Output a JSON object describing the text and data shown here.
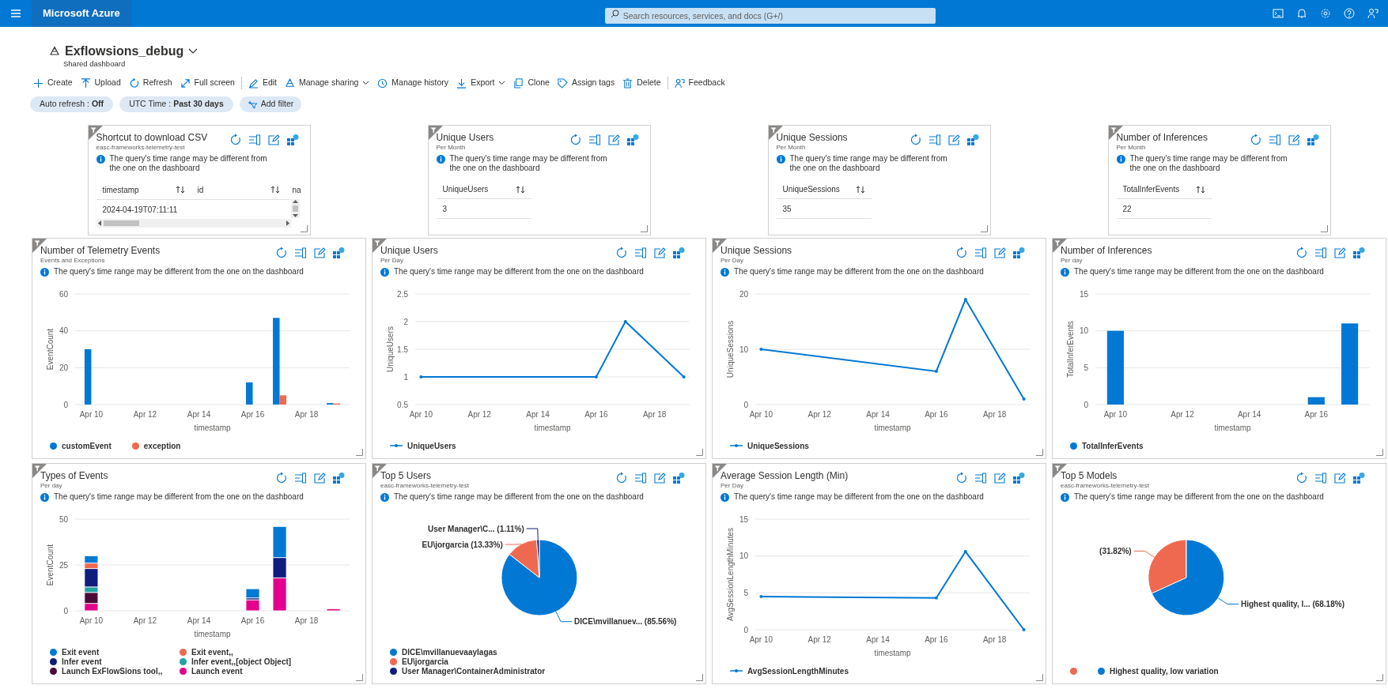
{
  "topbar": {
    "brand": "Microsoft Azure",
    "search": {
      "placeholder": "Search resources, services, and docs (G+/)"
    }
  },
  "dashboard": {
    "title": "Exflowsions_debug",
    "subtitle": "Shared dashboard"
  },
  "toolbar": [
    [
      {
        "label": "Create",
        "has_menu": false
      },
      {
        "label": "Upload",
        "has_menu": false
      },
      {
        "label": "Refresh",
        "has_menu": false
      },
      {
        "label": "Full screen",
        "has_menu": false
      }
    ],
    [
      {
        "label": "Edit",
        "has_menu": false
      },
      {
        "label": "Manage sharing",
        "has_menu": true
      },
      {
        "label": "Manage history",
        "has_menu": false
      },
      {
        "label": "Export",
        "has_menu": true
      },
      {
        "label": "Clone",
        "has_menu": false
      },
      {
        "label": "Assign tags",
        "has_menu": false
      },
      {
        "label": "Delete",
        "has_menu": false
      }
    ],
    [
      {
        "label": "Feedback",
        "has_menu": false
      }
    ]
  ],
  "filters": [
    {
      "kind": "value",
      "text": "Auto refresh : **Off**"
    },
    {
      "kind": "value",
      "text": "UTC Time : **Past 30 days**"
    },
    {
      "kind": "add",
      "text": "Add filter"
    }
  ],
  "tiles": [
    {
      "kind": "table",
      "title": "Shortcut to download CSV",
      "subtitle": "easc-frameworks-telemetry-test",
      "notice": "The query's time range may be different from the one on the dashboard",
      "scrollbars": true,
      "table": {
        "columns": [
          {
            "label": "timestamp",
            "sortable": true
          },
          {
            "label": "id",
            "sortable": true
          },
          {
            "label": "na",
            "sortable": false
          }
        ],
        "rows": [
          [
            "2024-04-19T07:11:11"
          ]
        ]
      }
    },
    {
      "kind": "table",
      "title": "Unique Users",
      "subtitle": "Per Month",
      "notice": "The query's time range may be different from the one on the dashboard",
      "scrollbars": false,
      "table": {
        "columns": [
          {
            "label": "UniqueUsers",
            "sortable": true
          }
        ],
        "rows": [
          [
            "3"
          ]
        ]
      }
    },
    {
      "kind": "table",
      "title": "Unique Sessions",
      "subtitle": "Per Month",
      "notice": "The query's time range may be different from the one on the dashboard",
      "scrollbars": false,
      "table": {
        "columns": [
          {
            "label": "UniqueSessions",
            "sortable": true
          }
        ],
        "rows": [
          [
            "35"
          ]
        ]
      }
    },
    {
      "kind": "table",
      "title": "Number of Inferences",
      "subtitle": "Per Month",
      "notice": "The query's time range may be different from the one on the dashboard",
      "scrollbars": false,
      "table": {
        "columns": [
          {
            "label": "TotalInferEvents",
            "sortable": true
          }
        ],
        "rows": [
          [
            "22"
          ]
        ]
      }
    },
    {
      "kind": "chart",
      "title": "Number of Telemetry Events",
      "subtitle": "Events and Exceptions",
      "notice": "The query's time range may be different from the one on the dashboard",
      "chart_data": {
        "type": "bar",
        "xlabel": "timestamp",
        "ylabel": "EventCount",
        "categories": [
          "Apr 10",
          null,
          "Apr 12",
          null,
          "Apr 14",
          null,
          "Apr 16",
          null,
          "Apr 18",
          null
        ],
        "grid": true,
        "ylim": [
          0,
          60
        ],
        "yticks": [
          0,
          20,
          40,
          60
        ],
        "stacked": false,
        "series": [
          {
            "name": "customEvent",
            "color": "#0078d4",
            "values": [
              30,
              null,
              null,
              null,
              null,
              null,
              12,
              47,
              null,
              0.8
            ]
          },
          {
            "name": "exception",
            "color": "#ef6950",
            "values": [
              null,
              null,
              null,
              null,
              null,
              null,
              null,
              5,
              null,
              0.6
            ]
          }
        ]
      }
    },
    {
      "kind": "chart",
      "title": "Unique Users",
      "subtitle": "Per Day",
      "notice": "The query's time range may be different from the one on the dashboard",
      "chart_data": {
        "type": "line",
        "xlabel": "timestamp",
        "ylabel": "UniqueUsers",
        "categories": [
          "Apr 10",
          null,
          "Apr 12",
          null,
          "Apr 14",
          null,
          "Apr 16",
          null,
          "Apr 18",
          null
        ],
        "grid": true,
        "ylim": [
          0.5,
          2.5
        ],
        "yticks": [
          0.5,
          1,
          1.5,
          2,
          2.5
        ],
        "series": [
          {
            "name": "UniqueUsers",
            "color": "#0078d4",
            "values": [
              1,
              null,
              null,
              null,
              null,
              null,
              1,
              2,
              null,
              1
            ]
          }
        ]
      }
    },
    {
      "kind": "chart",
      "title": "Unique Sessions",
      "subtitle": "Per Day",
      "notice": "The query's time range may be different from the one on the dashboard",
      "chart_data": {
        "type": "line",
        "xlabel": "timestamp",
        "ylabel": "UniqueSessions",
        "categories": [
          "Apr 10",
          null,
          "Apr 12",
          null,
          "Apr 14",
          null,
          "Apr 16",
          null,
          "Apr 18",
          null
        ],
        "grid": true,
        "ylim": [
          0,
          20
        ],
        "yticks": [
          0,
          10,
          20
        ],
        "series": [
          {
            "name": "UniqueSessions",
            "color": "#0078d4",
            "values": [
              10,
              null,
              null,
              null,
              null,
              null,
              6,
              19,
              null,
              1
            ]
          }
        ]
      }
    },
    {
      "kind": "chart",
      "title": "Number of Inferences",
      "subtitle": "Per day",
      "notice": "The query's time range may be different from the one on the dashboard",
      "chart_data": {
        "type": "bar",
        "xlabel": "timestamp",
        "ylabel": "TotalInferEvents",
        "categories": [
          "Apr 10",
          null,
          "Apr 12",
          null,
          "Apr 14",
          null,
          "Apr 16",
          null
        ],
        "grid": true,
        "ylim": [
          0,
          15
        ],
        "yticks": [
          0,
          5,
          10,
          15
        ],
        "stacked": false,
        "series": [
          {
            "name": "TotalInferEvents",
            "color": "#0078d4",
            "values": [
              10,
              null,
              null,
              null,
              null,
              null,
              1,
              11
            ]
          }
        ]
      }
    },
    {
      "kind": "chart",
      "title": "Types of Events",
      "subtitle": "Per day",
      "notice": "The query's time range may be different from the one on the dashboard",
      "chart_data": {
        "type": "bar",
        "xlabel": "timestamp",
        "ylabel": "EventCount",
        "categories": [
          "Apr 10",
          null,
          "Apr 12",
          null,
          "Apr 14",
          null,
          "Apr 16",
          null,
          "Apr 18",
          null
        ],
        "grid": true,
        "ylim": [
          0,
          50
        ],
        "yticks": [
          0,
          25,
          50
        ],
        "stacked": true,
        "series": [
          {
            "name": "Exit event",
            "color": "#0078d4",
            "values": [
              4,
              null,
              null,
              null,
              null,
              null,
              5,
              17,
              null,
              null
            ]
          },
          {
            "name": "Exit event,,",
            "color": "#ef6950",
            "values": [
              3,
              null,
              null,
              null,
              null,
              null,
              null,
              null,
              null,
              null
            ]
          },
          {
            "name": "Infer event",
            "color": "#0f1d7d",
            "values": [
              10,
              null,
              null,
              null,
              null,
              null,
              1,
              11,
              null,
              null
            ]
          },
          {
            "name": "Infer event,,[object Object]",
            "color": "#23a3a3",
            "values": [
              3,
              null,
              null,
              null,
              null,
              null,
              null,
              null,
              null,
              null
            ]
          },
          {
            "name": "Launch ExFlowSions tool,,",
            "color": "#4b0a38",
            "values": [
              6,
              null,
              null,
              null,
              null,
              null,
              null,
              null,
              null,
              null
            ]
          },
          {
            "name": "Launch event",
            "color": "#e3008c",
            "values": [
              4,
              null,
              null,
              null,
              null,
              null,
              6,
              18,
              null,
              1
            ]
          }
        ]
      }
    },
    {
      "kind": "chart",
      "title": "Top 5 Users",
      "subtitle": "easc-frameworks-telemetry-test",
      "notice": "The query's time range may be different from the one on the dashboard",
      "chart_data": {
        "type": "pie",
        "values": [
          85.56,
          13.33,
          1.11
        ],
        "colors": [
          "#0078d4",
          "#ef6950",
          "#0f1d7d"
        ],
        "value_labels": [
          "DICE\\mvillanuev... (85.56%)",
          "EU\\jorgarcia (13.33%)",
          "User Manager\\C... (1.11%)"
        ]
      },
      "legend": [
        {
          "label": "DICE\\mvillanuevaaylagas",
          "color": "#0078d4"
        },
        {
          "label": "EU\\jorgarcia",
          "color": "#ef6950"
        },
        {
          "label": "User Manager\\ContainerAdministrator",
          "color": "#0f1d7d"
        }
      ]
    },
    {
      "kind": "chart",
      "title": "Average Session Length (Min)",
      "subtitle": "Per Day",
      "notice": "The query's time range may be different from the one on the dashboard",
      "chart_data": {
        "type": "line",
        "xlabel": "timestamp",
        "ylabel": "AvgSessionLengthMinutes",
        "categories": [
          "Apr 10",
          null,
          "Apr 12",
          null,
          "Apr 14",
          null,
          "Apr 16",
          null,
          "Apr 18",
          null
        ],
        "grid": true,
        "ylim": [
          0,
          15
        ],
        "yticks": [
          0,
          5,
          10,
          15
        ],
        "series": [
          {
            "name": "AvgSessionLengthMinutes",
            "color": "#0078d4",
            "values": [
              4.5,
              null,
              null,
              null,
              null,
              null,
              4.3,
              10.6,
              null,
              0
            ]
          }
        ]
      }
    },
    {
      "kind": "chart",
      "title": "Top 5 Models",
      "subtitle": "easc-frameworks-telemetry-test",
      "notice": "The query's time range may be different from the one on the dashboard",
      "chart_data": {
        "type": "pie",
        "values": [
          68.18,
          31.82
        ],
        "colors": [
          "#0078d4",
          "#ef6950"
        ],
        "value_labels": [
          "Highest quality, l... (68.18%)",
          "(31.82%)"
        ]
      },
      "legend": [
        {
          "color": "#ef6950"
        },
        {
          "label": "Highest quality, low variation",
          "color": "#0078d4"
        }
      ]
    }
  ]
}
